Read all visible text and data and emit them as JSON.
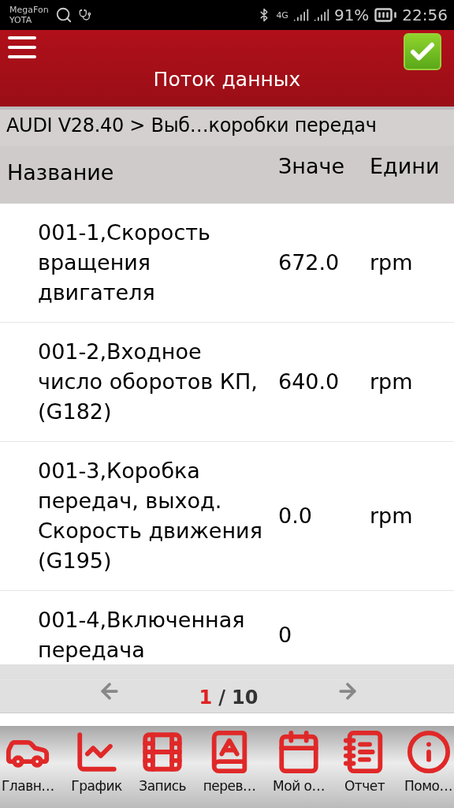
{
  "status_bar": {
    "carriers": [
      "MegaFon",
      "YOTA"
    ],
    "network": "4G",
    "battery": "91%",
    "time": "22:56"
  },
  "header": {
    "title": "Поток данных"
  },
  "breadcrumb": "AUDI V28.40 > Выб…коробки передач",
  "columns": [
    "Название",
    "Значе",
    "Едини"
  ],
  "rows": [
    {
      "name": "001-1,Скорость вращения двигателя",
      "value": "672.0",
      "unit": "rpm"
    },
    {
      "name": "001-2,Входное число оборотов КП, (G182)",
      "value": "640.0",
      "unit": "rpm"
    },
    {
      "name": "001-3,Коробка передач, выход. Скорость движения (G195)",
      "value": "0.0",
      "unit": "rpm"
    },
    {
      "name": "001-4,Включенная передача",
      "value": "0"
    }
  ],
  "pagination": {
    "current": "1",
    "separator": "/",
    "total": "10"
  },
  "toolbar": [
    {
      "kind": "car",
      "label": "Главн…"
    },
    {
      "kind": "graph",
      "label": "График"
    },
    {
      "kind": "record",
      "label": "Запись"
    },
    {
      "kind": "translate",
      "label": "перев…"
    },
    {
      "kind": "calendar",
      "label": "Мой о…"
    },
    {
      "kind": "report",
      "label": "Отчет"
    },
    {
      "kind": "info",
      "label": "Помо…"
    }
  ]
}
